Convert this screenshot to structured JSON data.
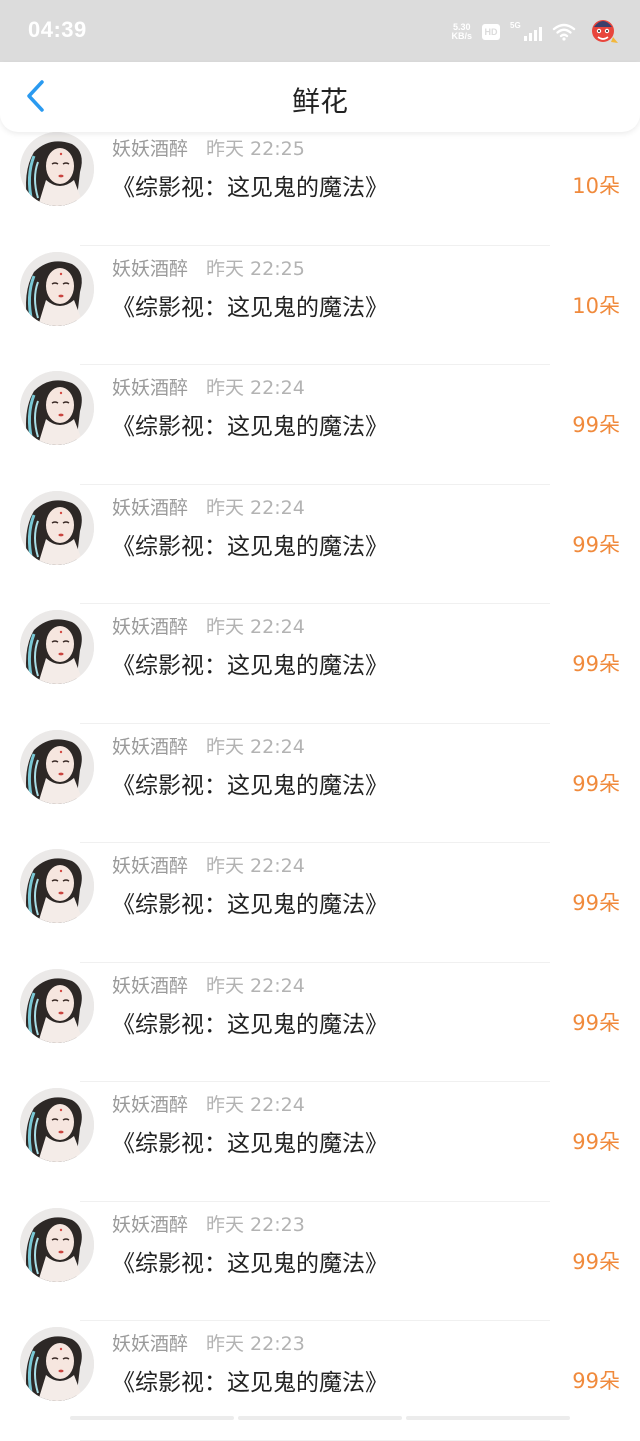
{
  "status_bar": {
    "time": "04:39",
    "net_speed_value": "5.30",
    "net_speed_unit": "KB/s",
    "hd_label": "HD",
    "signal_label": "5G"
  },
  "header": {
    "title": "鲜花"
  },
  "colors": {
    "accent_blue": "#2a9af0",
    "count_orange": "#f08a3c"
  },
  "items": [
    {
      "user": "妖妖酒醉",
      "time": "昨天 22:25",
      "book": "《综影视：这见鬼的魔法》",
      "count": "10朵"
    },
    {
      "user": "妖妖酒醉",
      "time": "昨天 22:25",
      "book": "《综影视：这见鬼的魔法》",
      "count": "10朵"
    },
    {
      "user": "妖妖酒醉",
      "time": "昨天 22:24",
      "book": "《综影视：这见鬼的魔法》",
      "count": "99朵"
    },
    {
      "user": "妖妖酒醉",
      "time": "昨天 22:24",
      "book": "《综影视：这见鬼的魔法》",
      "count": "99朵"
    },
    {
      "user": "妖妖酒醉",
      "time": "昨天 22:24",
      "book": "《综影视：这见鬼的魔法》",
      "count": "99朵"
    },
    {
      "user": "妖妖酒醉",
      "time": "昨天 22:24",
      "book": "《综影视：这见鬼的魔法》",
      "count": "99朵"
    },
    {
      "user": "妖妖酒醉",
      "time": "昨天 22:24",
      "book": "《综影视：这见鬼的魔法》",
      "count": "99朵"
    },
    {
      "user": "妖妖酒醉",
      "time": "昨天 22:24",
      "book": "《综影视：这见鬼的魔法》",
      "count": "99朵"
    },
    {
      "user": "妖妖酒醉",
      "time": "昨天 22:24",
      "book": "《综影视：这见鬼的魔法》",
      "count": "99朵"
    },
    {
      "user": "妖妖酒醉",
      "time": "昨天 22:23",
      "book": "《综影视：这见鬼的魔法》",
      "count": "99朵"
    },
    {
      "user": "妖妖酒醉",
      "time": "昨天 22:23",
      "book": "《综影视：这见鬼的魔法》",
      "count": "99朵"
    }
  ]
}
